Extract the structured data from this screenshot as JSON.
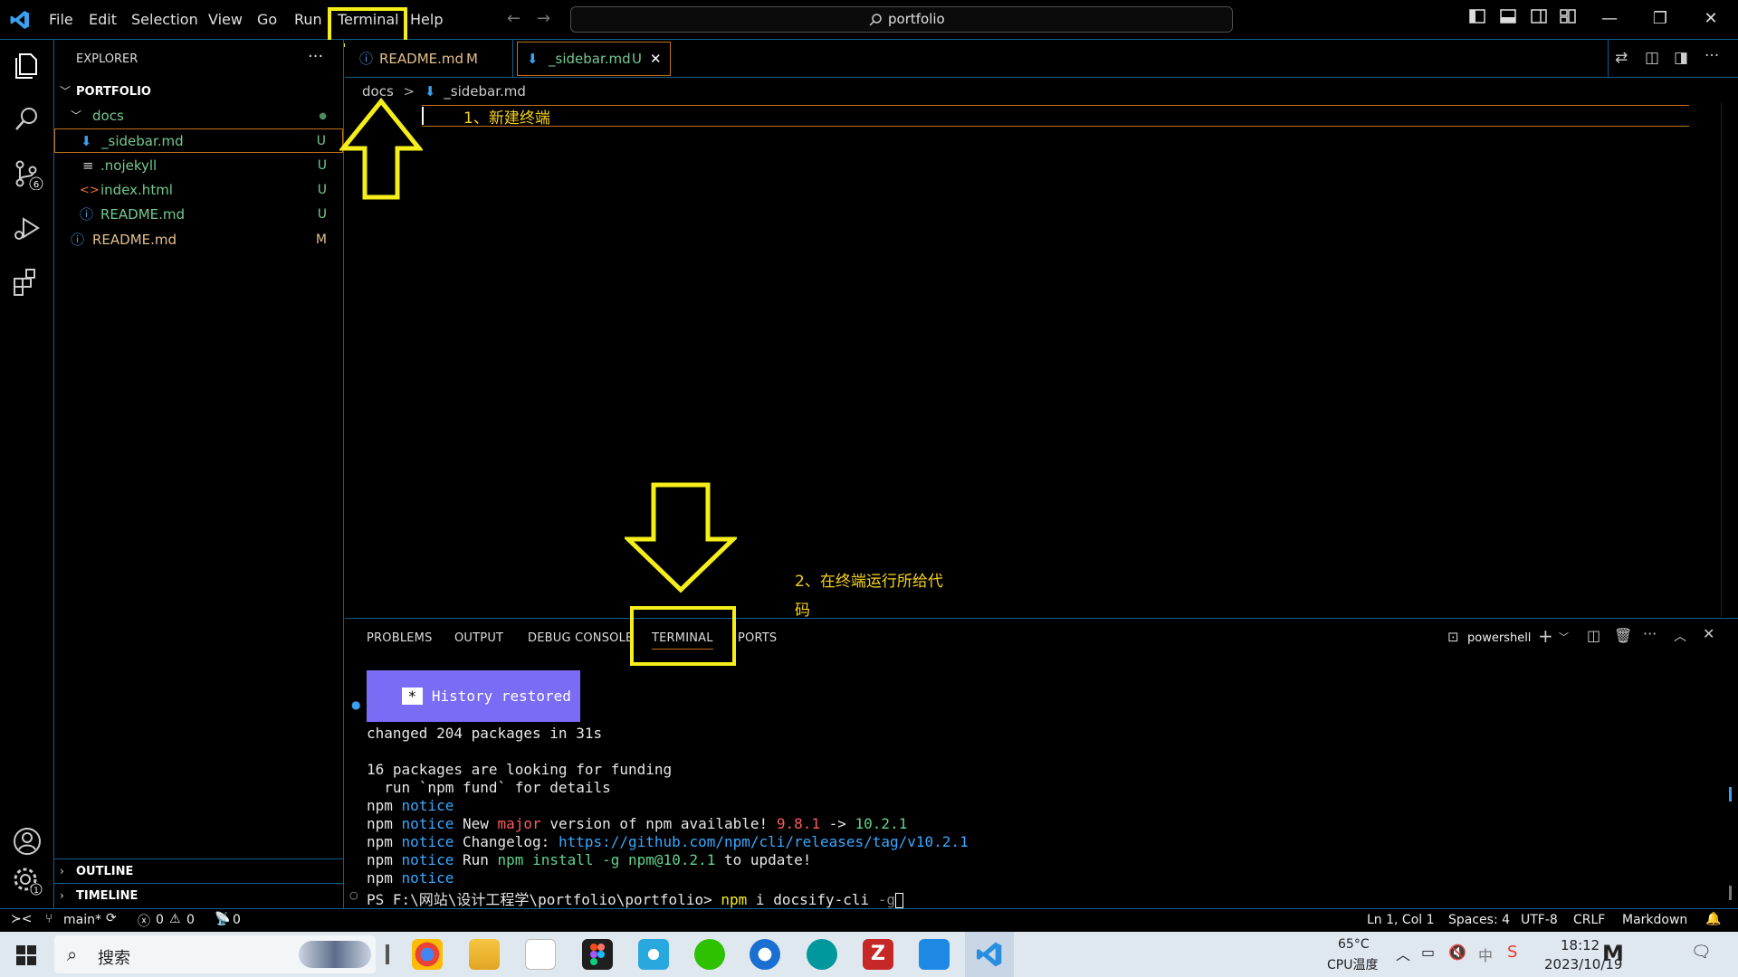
{
  "menu": [
    "File",
    "Edit",
    "Selection",
    "View",
    "Go",
    "Run",
    "Terminal",
    "Help"
  ],
  "search": {
    "text": "portfolio"
  },
  "explorer": {
    "title": "EXPLORER",
    "more": "···",
    "root": "PORTFOLIO",
    "items": [
      {
        "label": "docs",
        "badge": "●",
        "type": "folder"
      },
      {
        "label": "_sidebar.md",
        "badge": "U",
        "type": "md"
      },
      {
        "label": ".nojekyll",
        "badge": "U",
        "type": "text"
      },
      {
        "label": "index.html",
        "badge": "U",
        "type": "html"
      },
      {
        "label": "README.md",
        "badge": "U",
        "type": "info"
      },
      {
        "label": "README.md",
        "badge": "M",
        "type": "info"
      }
    ],
    "outline": "OUTLINE",
    "timeline": "TIMELINE"
  },
  "tabs": [
    {
      "label": "README.md",
      "badge": "M"
    },
    {
      "label": "_sidebar.md",
      "badge": "U",
      "close": "✕"
    }
  ],
  "breadcrumb": {
    "folder": "docs",
    "sep": ">",
    "file": "_sidebar.md"
  },
  "annotations": {
    "step1": "1、新建终端",
    "step2_line1": "2、在终端运行所给代",
    "step2_line2": "码"
  },
  "panel": {
    "tabs": [
      "PROBLEMS",
      "OUTPUT",
      "DEBUG CONSOLE",
      "TERMINAL",
      "PORTS"
    ],
    "shell": "powershell"
  },
  "terminal": {
    "history_star": "*",
    "history": "History restored",
    "line1": "changed 204 packages in 31s",
    "line2": "16 packages are looking for funding",
    "line3": "  run `npm fund` for details",
    "npm": "npm",
    "notice": "notice",
    "new_word": "New",
    "major": "major",
    "avail": "version of npm available!",
    "old_ver": "9.8.1",
    "arrow": "->",
    "new_ver": "10.2.1",
    "changelog_label": "Changelog:",
    "changelog_url": "https://github.com/npm/cli/releases/tag/v10.2.1",
    "run_word": "Run",
    "run_cmd": "npm install -g npm@10.2.1",
    "to_update": "to update!",
    "prompt": "PS F:\\网站\\设计工程学\\portfolio\\portfolio>",
    "cmd_npm": "npm",
    "cmd_rest": "i docsify-cli",
    "cmd_flag": "-g"
  },
  "status": {
    "branch": "main*",
    "errors": "0",
    "warnings": "0",
    "ports": "0",
    "position": "Ln 1, Col 1",
    "spaces": "Spaces: 4",
    "encoding": "UTF-8",
    "eol": "CRLF",
    "language": "Markdown"
  },
  "taskbar": {
    "search_label": "搜索",
    "temp": "65°C",
    "temp_label": "CPU温度",
    "ime": "中",
    "time": "18:12",
    "date": "2023/10/19"
  },
  "colors": {
    "accent": "#0e5e8e",
    "annotation": "#f5ee1a",
    "modified": "#e2c08d",
    "untracked": "#73c991"
  }
}
